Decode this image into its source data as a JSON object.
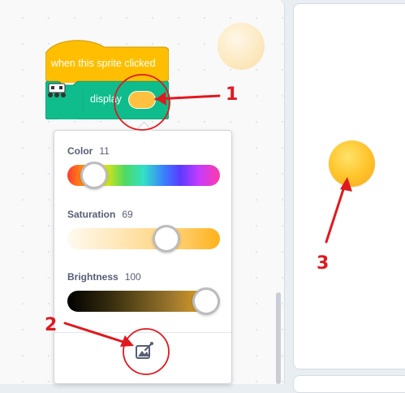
{
  "hat_block": {
    "label": "when this sprite clicked"
  },
  "display_block": {
    "label": "display",
    "swatch_color": "#ffc13f"
  },
  "color_picker": {
    "color": {
      "label": "Color",
      "value": "11",
      "fraction": 0.11
    },
    "saturation": {
      "label": "Saturation",
      "value": "69",
      "fraction": 0.69
    },
    "brightness": {
      "label": "Brightness",
      "value": "100",
      "fraction": 1.0
    },
    "eyedropper_icon": "eyedropper-icon"
  },
  "annotations": {
    "one": "1",
    "two": "2",
    "three": "3"
  },
  "colors": {
    "block_orange": "#ffbf00",
    "block_green": "#0fbd8c",
    "annotation_red": "#e0191f",
    "sprite_yellow": "#ffc52c"
  }
}
